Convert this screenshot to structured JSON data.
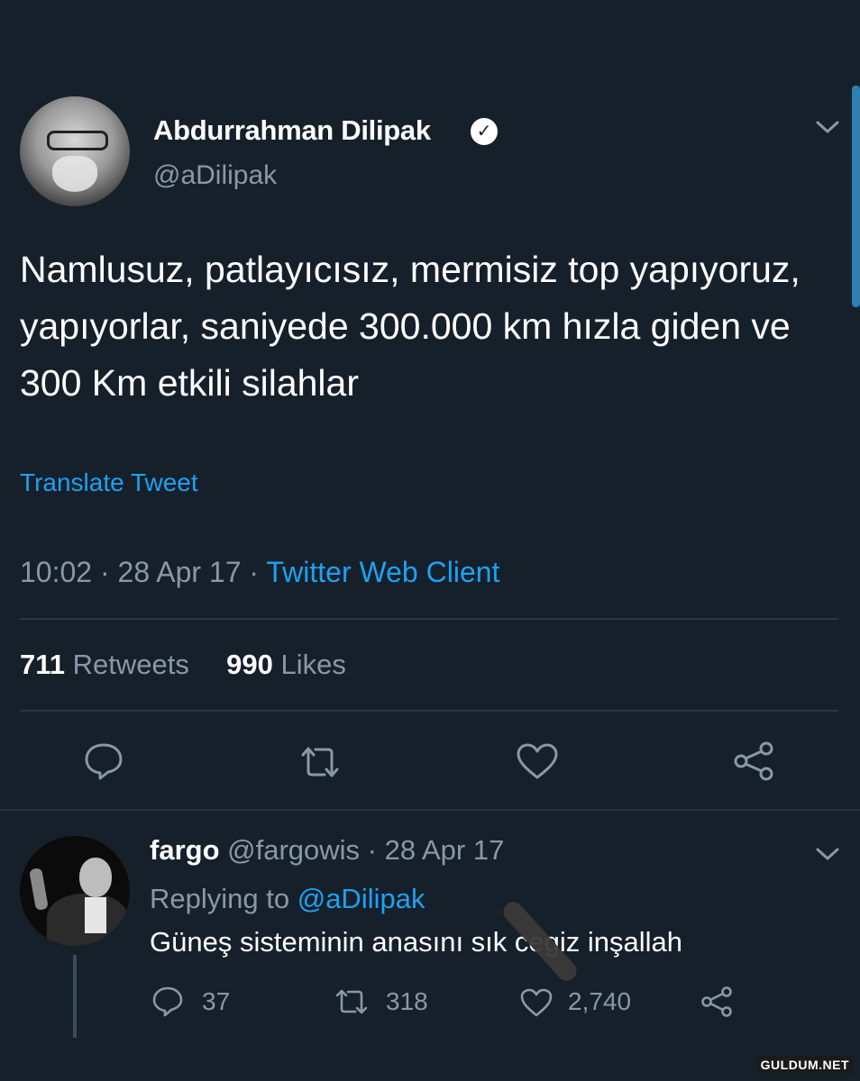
{
  "tweet": {
    "author_name": "Abdurrahman Dilipak",
    "handle": "@aDilipak",
    "text": "Namlusuz, patlayıcısız, mermisiz top yapıyoruz, yapıyorlar, saniyede 300.000 km hızla giden ve 300 Km etkili silahlar",
    "translate_label": "Translate Tweet",
    "time": "10:02",
    "date": "28 Apr 17",
    "separator": "·",
    "client": "Twitter Web Client",
    "retweets_count": "711",
    "retweets_label": "Retweets",
    "likes_count": "990",
    "likes_label": "Likes"
  },
  "reply": {
    "author_name": "fargo",
    "handle": "@fargowis",
    "date": "· 28 Apr 17",
    "replying_to_label": "Replying to",
    "replying_to_handle": "@aDilipak",
    "text": "Güneş sisteminin anasını sık cegiz inşallah",
    "reply_count": "37",
    "retweet_count": "318",
    "like_count": "2,740"
  },
  "watermark": "GULDUM.NET",
  "icons": [
    "verified-badge-icon",
    "chevron-down-icon",
    "reply-icon",
    "retweet-icon",
    "like-icon",
    "share-icon"
  ],
  "colors": {
    "background": "#16202b",
    "accent": "#1da1f2",
    "muted": "#8899a6"
  }
}
